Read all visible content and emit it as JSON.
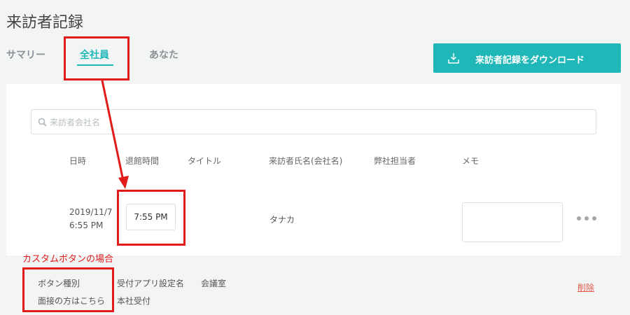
{
  "page": {
    "title": "来訪者記録"
  },
  "tabs": [
    {
      "label": "サマリー"
    },
    {
      "label": "全社員"
    },
    {
      "label": "あなた"
    }
  ],
  "download_button": {
    "label": "来訪者記録をダウンロード",
    "icon": "download-icon"
  },
  "search": {
    "placeholder": "来訪者会社名",
    "value": "",
    "icon": "search-icon"
  },
  "table": {
    "headers": [
      "日時",
      "退館時間",
      "タイトル",
      "来訪者氏名(会社名)",
      "弊社担当者",
      "メモ"
    ],
    "row": {
      "date": "2019/11/7",
      "time": "6:55 PM",
      "exit_time": "7:55 PM",
      "visitor_name": "タナカ",
      "memo": ""
    }
  },
  "annotation": {
    "custom_button_note": "カスタムボタンの場合"
  },
  "details": {
    "button_type_label": "ボタン種別",
    "button_type_value": "面接の方はこちら",
    "app_setting_label": "受付アプリ設定名",
    "app_setting_value": "本社受付",
    "meeting_room_label": "会議室",
    "delete_label": "削除"
  },
  "colors": {
    "accent": "#1fb7b7",
    "annotation": "#e11a1a",
    "delete": "#e05a4a"
  }
}
